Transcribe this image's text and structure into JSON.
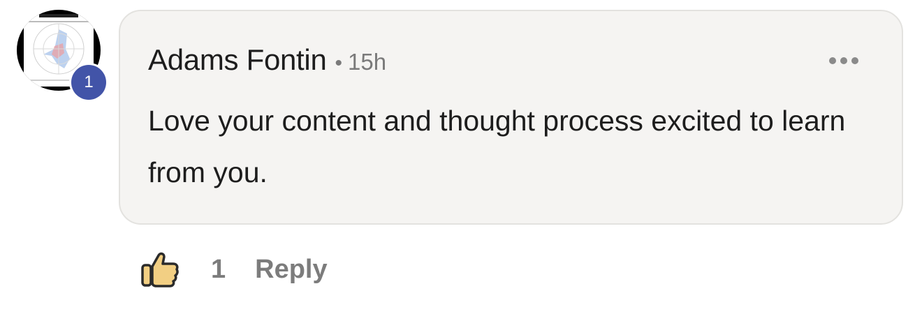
{
  "comment": {
    "author": "Adams Fontin",
    "separator": "•",
    "timestamp": "15h",
    "text": "Love your content and thought process excited to learn from you."
  },
  "avatar": {
    "badge_count": "1",
    "badge_color": "#4254a8"
  },
  "actions": {
    "like_icon": "thumbs-up-icon",
    "like_count": "1",
    "reply_label": "Reply"
  },
  "menu": {
    "icon": "more-options-icon"
  },
  "colors": {
    "bubble_background": "#f5f4f2",
    "like_icon_fill": "#f2cf83",
    "muted_text": "#7c7c7c"
  }
}
